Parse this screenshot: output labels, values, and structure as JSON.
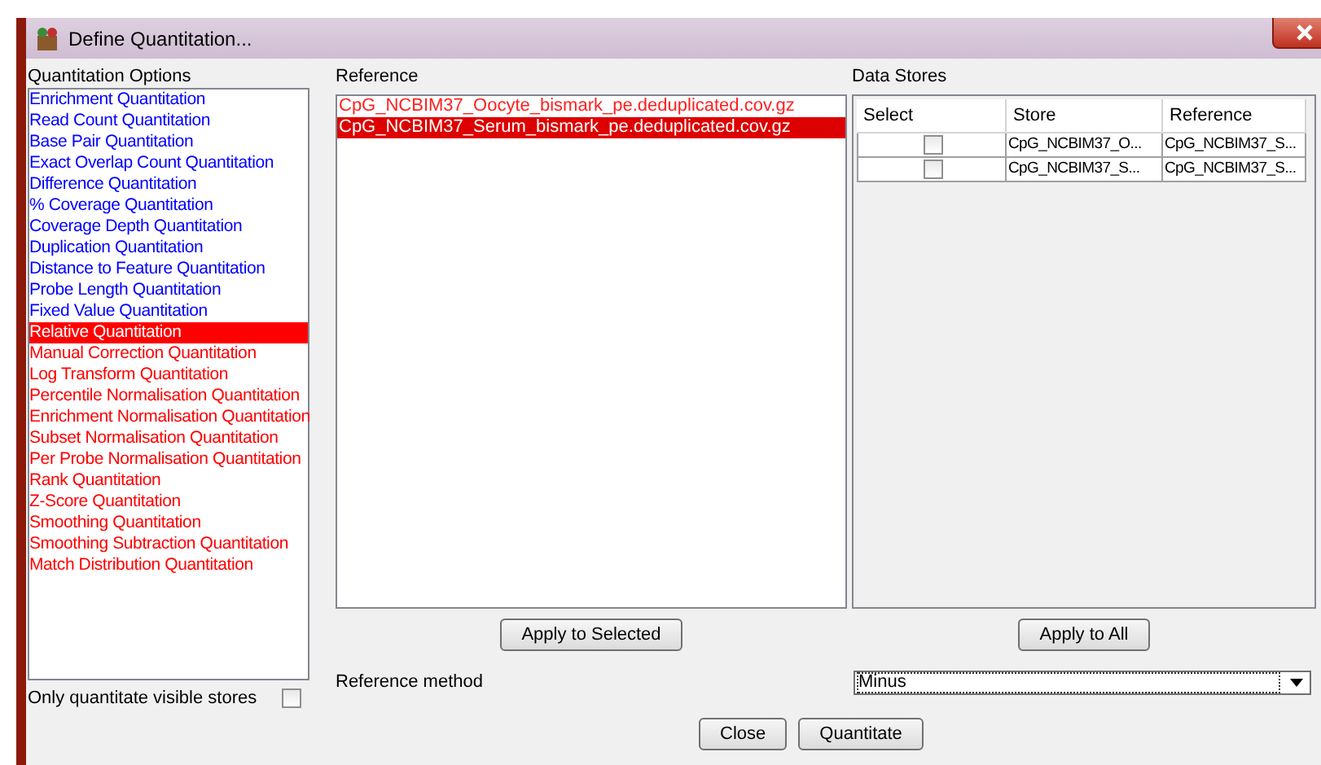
{
  "window": {
    "title": "Define Quantitation..."
  },
  "options": {
    "label": "Quantitation Options",
    "items": [
      {
        "label": "Enrichment Quantitation",
        "color": "#0000ff",
        "selected": false
      },
      {
        "label": "Read Count Quantitation",
        "color": "#0000ff",
        "selected": false
      },
      {
        "label": "Base Pair Quantitation",
        "color": "#0000ff",
        "selected": false
      },
      {
        "label": "Exact Overlap Count Quantitation",
        "color": "#0000ff",
        "selected": false
      },
      {
        "label": "Difference Quantitation",
        "color": "#0000ff",
        "selected": false
      },
      {
        "label": "% Coverage Quantitation",
        "color": "#0000ff",
        "selected": false
      },
      {
        "label": "Coverage Depth Quantitation",
        "color": "#0000ff",
        "selected": false
      },
      {
        "label": "Duplication Quantitation",
        "color": "#0000ff",
        "selected": false
      },
      {
        "label": "Distance to Feature Quantitation",
        "color": "#0000ff",
        "selected": false
      },
      {
        "label": "Probe Length Quantitation",
        "color": "#0000ff",
        "selected": false
      },
      {
        "label": "Fixed Value Quantitation",
        "color": "#0000ff",
        "selected": false
      },
      {
        "label": "Relative Quantitation",
        "color": "#ff0000",
        "selected": true
      },
      {
        "label": "Manual Correction Quantitation",
        "color": "#ff0000",
        "selected": false
      },
      {
        "label": "Log Transform Quantitation",
        "color": "#ff0000",
        "selected": false
      },
      {
        "label": "Percentile Normalisation Quantitation",
        "color": "#ff0000",
        "selected": false
      },
      {
        "label": "Enrichment Normalisation Quantitation",
        "color": "#ff0000",
        "selected": false
      },
      {
        "label": "Subset Normalisation Quantitation",
        "color": "#ff0000",
        "selected": false
      },
      {
        "label": "Per Probe Normalisation Quantitation",
        "color": "#ff0000",
        "selected": false
      },
      {
        "label": "Rank Quantitation",
        "color": "#ff0000",
        "selected": false
      },
      {
        "label": "Z-Score Quantitation",
        "color": "#ff0000",
        "selected": false
      },
      {
        "label": "Smoothing Quantitation",
        "color": "#ff0000",
        "selected": false
      },
      {
        "label": "Smoothing Subtraction Quantitation",
        "color": "#ff0000",
        "selected": false
      },
      {
        "label": "Match Distribution Quantitation",
        "color": "#ff0000",
        "selected": false
      }
    ],
    "visible_only": {
      "label": "Only quantitate visible stores",
      "checked": false
    }
  },
  "reference": {
    "label": "Reference",
    "items": [
      {
        "label": "CpG_NCBIM37_Oocyte_bismark_pe.deduplicated.cov.gz",
        "selected": false
      },
      {
        "label": "CpG_NCBIM37_Serum_bismark_pe.deduplicated.cov.gz",
        "selected": true
      }
    ],
    "button": "Apply to Selected"
  },
  "data_stores": {
    "label": "Data Stores",
    "columns": [
      "Select",
      "Store",
      "Reference"
    ],
    "rows": [
      {
        "checked": false,
        "store": "CpG_NCBIM37_O...",
        "reference": "CpG_NCBIM37_S..."
      },
      {
        "checked": false,
        "store": "CpG_NCBIM37_S...",
        "reference": "CpG_NCBIM37_S..."
      }
    ],
    "button": "Apply to All"
  },
  "reference_method": {
    "label": "Reference method",
    "value": "Minus"
  },
  "buttons": [
    "Close",
    "Quantitate"
  ]
}
